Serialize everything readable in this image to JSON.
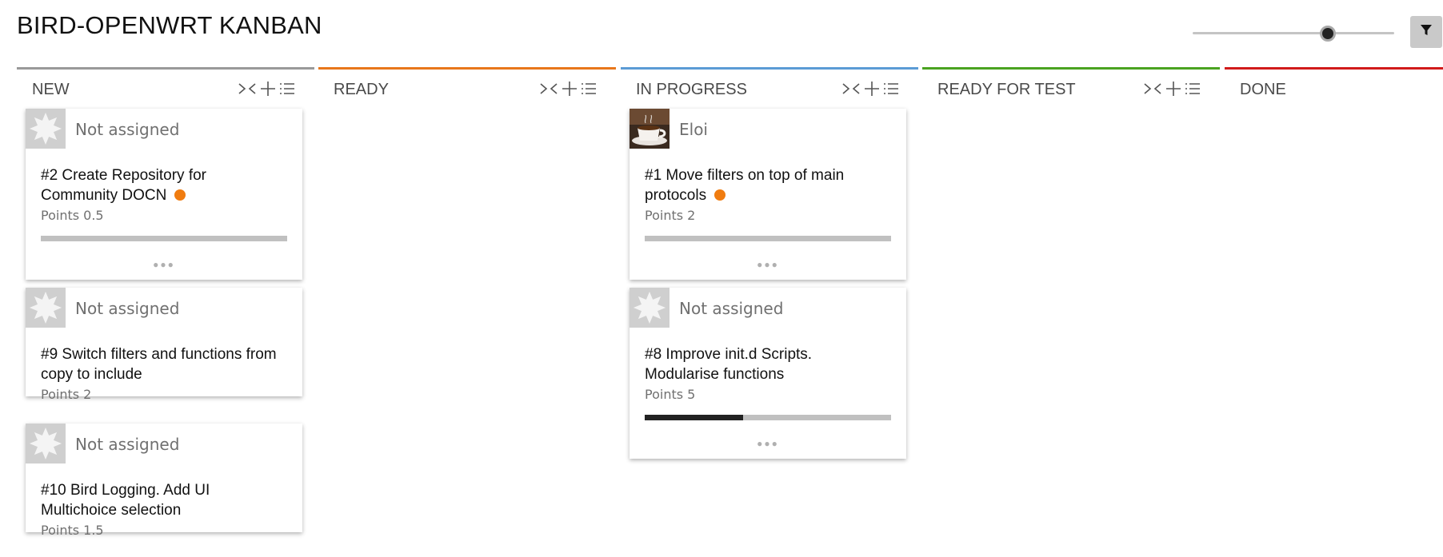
{
  "title": "BIRD-OPENWRT KANBAN",
  "zoom": {
    "value_fraction": 0.67
  },
  "icons": {
    "filter": "filter-icon",
    "collapse": "collapse-icon",
    "add": "plus-icon",
    "list": "list-icon",
    "more": "ellipsis-icon",
    "avatar_default": "snowflake-avatar-icon",
    "avatar_user": "coffee-cup-avatar"
  },
  "colors": {
    "new": "#999999",
    "ready": "#e8771b",
    "in_progress": "#5b9bd5",
    "ready_for_test": "#4aa320",
    "done": "#d11b1b",
    "status_dot": "#f07c10"
  },
  "columns": [
    {
      "title": "NEW",
      "cards": [
        {
          "assignee": "Not assigned",
          "title": "#2 Create Repository for Community DOCN",
          "has_dot": true,
          "points": "Points 0.5",
          "progress": 0.0,
          "has_progress": true,
          "has_more": true
        },
        {
          "assignee": "Not assigned",
          "title": "#9 Switch filters and functions from copy to include",
          "has_dot": false,
          "points": "Points 2",
          "progress": 0.0,
          "has_progress": false,
          "has_more": false
        },
        {
          "assignee": "Not assigned",
          "title": "#10 Bird Logging. Add UI Multichoice selection",
          "has_dot": false,
          "points": "Points 1.5",
          "progress": 0.0,
          "has_progress": false,
          "has_more": false
        }
      ]
    },
    {
      "title": "READY",
      "cards": []
    },
    {
      "title": "IN PROGRESS",
      "cards": [
        {
          "assignee": "Eloi",
          "title": "#1 Move filters on top of main protocols",
          "has_dot": true,
          "points": "Points 2",
          "progress": 0.0,
          "has_progress": true,
          "has_more": true,
          "avatar": "user"
        },
        {
          "assignee": "Not assigned",
          "title": "#8 Improve init.d Scripts. Modularise functions",
          "has_dot": false,
          "points": "Points 5",
          "progress": 0.4,
          "has_progress": true,
          "has_more": true
        }
      ]
    },
    {
      "title": "READY FOR TEST",
      "cards": []
    },
    {
      "title": "DONE",
      "cards": []
    }
  ]
}
